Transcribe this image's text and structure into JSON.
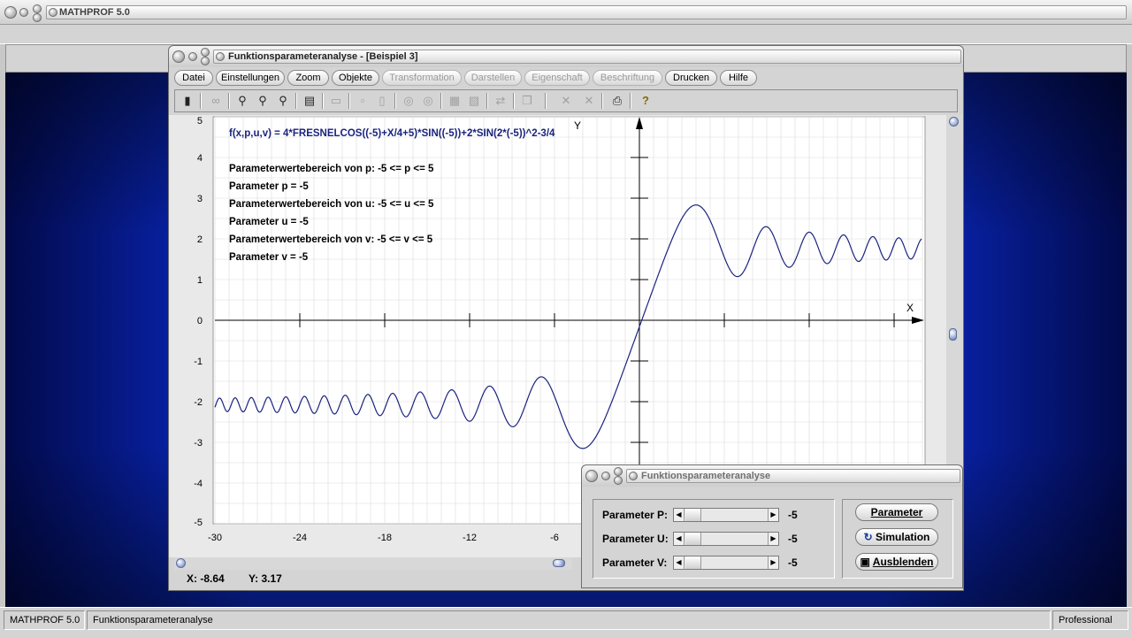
{
  "app": {
    "title": "MATHPROF 5.0",
    "status_left": "MATHPROF 5.0",
    "status_mid": "Funktionsparameteranalyse",
    "status_right": "Professional"
  },
  "window": {
    "title": "Funktionsparameteranalyse - [Beispiel 3]",
    "menu": [
      {
        "label": "Datei",
        "enabled": true
      },
      {
        "label": "Einstellungen",
        "enabled": true
      },
      {
        "label": "Zoom",
        "enabled": true
      },
      {
        "label": "Objekte",
        "enabled": true
      },
      {
        "label": "Transformation",
        "enabled": false
      },
      {
        "label": "Darstellen",
        "enabled": false
      },
      {
        "label": "Eigenschaft",
        "enabled": false
      },
      {
        "label": "Beschriftung",
        "enabled": false
      },
      {
        "label": "Drucken",
        "enabled": true
      },
      {
        "label": "Hilfe",
        "enabled": true
      }
    ],
    "toolbar_icons": [
      "exit-icon",
      "glasses-icon",
      "zoom-out-icon",
      "zoom-reset-icon",
      "zoom-in-icon",
      "properties-icon",
      "window-icon",
      "grid-small-icon",
      "grid-large-icon",
      "target-icon",
      "target-alt-icon",
      "table-icon",
      "table-alt-icon",
      "transfer-icon",
      "pages-icon",
      "cross-icon",
      "cross-alt-icon",
      "print-icon",
      "help-icon"
    ],
    "coord_x": "X: -8.64",
    "coord_y": "Y: 3.17"
  },
  "plot": {
    "formula": "f(x,p,u,v) = 4*FRESNELCOS((-5)+X/4+5)*SIN((-5))+2*SIN(2*(-5))^2-3/4",
    "info_lines": [
      "Parameterwertebereich von p: -5 <= p <= 5",
      "Parameter p = -5",
      "Parameterwertebereich von u: -5 <= u <= 5",
      "Parameter u = -5",
      "Parameterwertebereich von v: -5 <= v <= 5",
      "Parameter v = -5"
    ],
    "x_axis_label": "X",
    "y_axis_label": "Y",
    "curve_color": "#1a237e"
  },
  "chart_data": {
    "type": "line",
    "title": "f(x,p,u,v) = 4*FRESNELCOS((-5)+X/4+5)*SIN((-5))+2*SIN(2*(-5))^2-3/4",
    "xlabel": "X",
    "ylabel": "Y",
    "xlim": [
      -30,
      0
    ],
    "ylim": [
      -5,
      5
    ],
    "x_visible_range": [
      -30,
      0.1
    ],
    "xticks": [
      "-30",
      "-24",
      "-18",
      "-12",
      "-6",
      "0"
    ],
    "yticks": [
      "5",
      "4",
      "3",
      "2",
      "1",
      "0",
      "-1",
      "-2",
      "-3",
      "-4",
      "-5"
    ],
    "grid": true,
    "function": "4*C(x/4)*sin(-5) + 2*sin(-10)^2 - 0.75",
    "sample_points": [
      {
        "x": -30,
        "y": -1.95
      },
      {
        "x": -20,
        "y": -2.0
      },
      {
        "x": -14,
        "y": -1.95
      },
      {
        "x": -9.1,
        "y": -2.6
      },
      {
        "x": -7.0,
        "y": -1.45
      },
      {
        "x": -4.1,
        "y": -3.15
      },
      {
        "x": 0,
        "y": -0.04
      },
      {
        "x": 4.1,
        "y": 2.83
      },
      {
        "x": 7.0,
        "y": 1.1
      },
      {
        "x": 9.1,
        "y": 2.3
      },
      {
        "x": 20,
        "y": 1.85
      }
    ]
  },
  "param_dialog": {
    "title": "Funktionsparameteranalyse",
    "params": [
      {
        "label": "Parameter P:",
        "value": "-5",
        "position": 0.0
      },
      {
        "label": "Parameter U:",
        "value": "-5",
        "position": 0.0
      },
      {
        "label": "Parameter V:",
        "value": "-5",
        "position": 0.0
      }
    ],
    "btn_parameter": "Parameter",
    "btn_simulation": "Simulation",
    "btn_ausblenden": "Ausblenden"
  }
}
